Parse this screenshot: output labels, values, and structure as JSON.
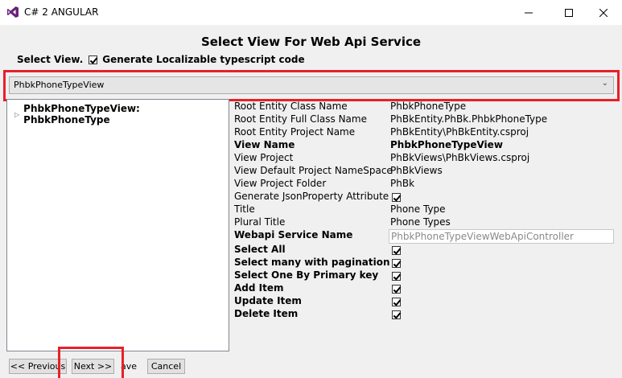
{
  "window": {
    "title": "C# 2 ANGULAR",
    "minimize_icon": "minimize-icon",
    "maximize_icon": "maximize-icon",
    "close_icon": "close-icon"
  },
  "heading": "Select View For Web Api Service",
  "select_view_label": "Select View.",
  "localizable_label": "Generate Localizable typescript code",
  "localizable_checked": true,
  "view_combo": {
    "selected": "PhbkPhoneTypeView"
  },
  "tree": {
    "root_label": "PhbkPhoneTypeView: PhbkPhoneType"
  },
  "properties": [
    {
      "label": "Root Entity Class Name",
      "value": "PhbkPhoneType",
      "bold": false
    },
    {
      "label": "Root Entity Full Class Name",
      "value": "PhBkEntity.PhBk.PhbkPhoneType",
      "bold": false
    },
    {
      "label": "Root Entity Project Name",
      "value": "PhBkEntity\\PhBkEntity.csproj",
      "bold": false
    },
    {
      "label": "View Name",
      "value": "PhbkPhoneTypeView",
      "bold": true
    },
    {
      "label": "View Project",
      "value": "PhBkViews\\PhBkViews.csproj",
      "bold": false
    },
    {
      "label": "View Default Project NameSpace",
      "value": "PhBkViews",
      "bold": false
    },
    {
      "label": "View Project Folder",
      "value": "PhBk",
      "bold": false
    },
    {
      "label": "Generate JsonProperty Attribute",
      "checked": true,
      "bold": false
    },
    {
      "label": "Title",
      "value": "Phone Type",
      "bold": false
    },
    {
      "label": "Plural Title",
      "value": "Phone Types",
      "bold": false
    },
    {
      "label": "Webapi Service Name",
      "value": "PhbkPhoneTypeViewWebApiController",
      "bold": true
    },
    {
      "label": "Select All",
      "checked": true,
      "bold": true
    },
    {
      "label": "Select many with pagination",
      "checked": true,
      "bold": true
    },
    {
      "label": "Select One By Primary key",
      "checked": true,
      "bold": true
    },
    {
      "label": "Add Item",
      "checked": true,
      "bold": true
    },
    {
      "label": "Update Item",
      "checked": true,
      "bold": true
    },
    {
      "label": "Delete Item",
      "checked": true,
      "bold": true
    }
  ],
  "buttons": {
    "previous": "<< Previous",
    "next": "Next >>",
    "save_partial": "ave",
    "cancel": "Cancel"
  },
  "colors": {
    "highlight_red": "#e8202a",
    "vs_purple": "#68217a"
  }
}
